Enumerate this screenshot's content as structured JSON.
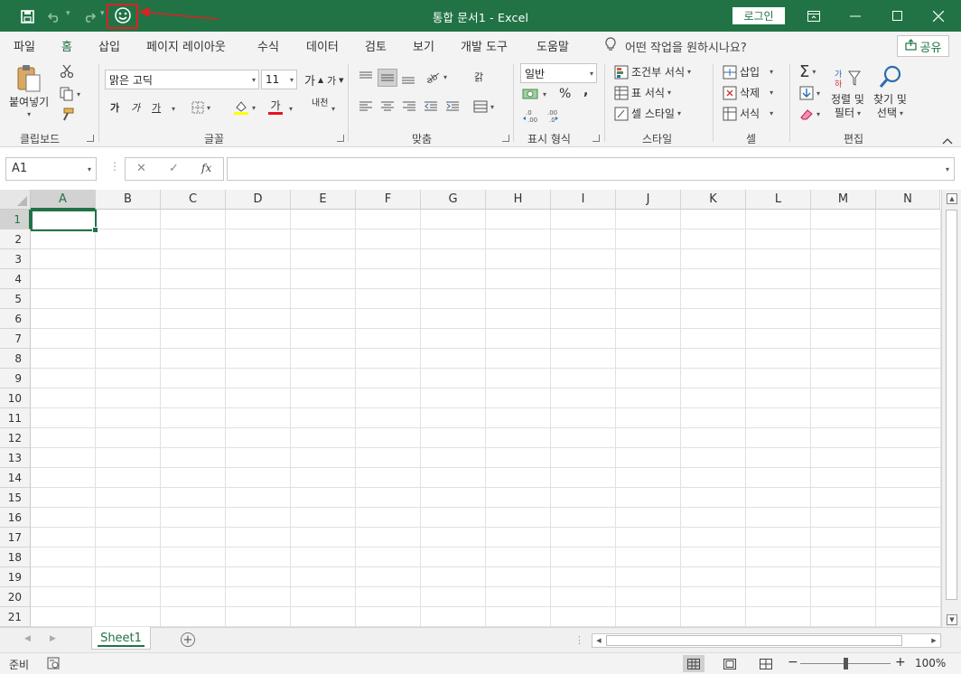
{
  "titlebar": {
    "title": "통합 문서1  -  Excel",
    "login_label": "로그인",
    "qat": {
      "save": "save-icon",
      "undo": "undo-icon",
      "redo": "redo-icon",
      "feedback": "smiley-icon"
    }
  },
  "tabs": [
    {
      "label": "파일"
    },
    {
      "label": "홈"
    },
    {
      "label": "삽입"
    },
    {
      "label": "페이지 레이아웃"
    },
    {
      "label": "수식"
    },
    {
      "label": "데이터"
    },
    {
      "label": "검토"
    },
    {
      "label": "보기"
    },
    {
      "label": "개발 도구"
    },
    {
      "label": "도움말"
    }
  ],
  "tell_me": "어떤 작업을 원하시나요?",
  "share_label": "공유",
  "ribbon": {
    "clipboard": {
      "paste_label": "붙여넣기",
      "group_label": "클립보드"
    },
    "font": {
      "font_name": "맑은 고딕",
      "font_size": "11",
      "grow": "가",
      "shrink": "가",
      "bold": "가",
      "italic": "가",
      "underline": "가",
      "font_color": "가",
      "phonetic": "내천",
      "group_label": "글꼴"
    },
    "alignment": {
      "wrap": "갉",
      "group_label": "맞춤"
    },
    "number": {
      "format": "일반",
      "percent": "%",
      "comma": ",",
      "group_label": "표시 형식"
    },
    "styles": {
      "conditional": "조건부 서식",
      "table": "표 서식",
      "cell_styles": "셀 스타일",
      "group_label": "스타일"
    },
    "cells": {
      "insert": "삽입",
      "delete": "삭제",
      "format": "서식",
      "group_label": "셀"
    },
    "editing": {
      "sort_line1": "정렬 및",
      "sort_line2": "필터",
      "find_line1": "찾기 및",
      "find_line2": "선택",
      "group_label": "편집"
    }
  },
  "formula_bar": {
    "name_box": "A1",
    "fx": "fx",
    "formula": ""
  },
  "grid": {
    "columns": [
      "A",
      "B",
      "C",
      "D",
      "E",
      "F",
      "G",
      "H",
      "I",
      "J",
      "K",
      "L",
      "M",
      "N"
    ],
    "rows": [
      "1",
      "2",
      "3",
      "4",
      "5",
      "6",
      "7",
      "8",
      "9",
      "10",
      "11",
      "12",
      "13",
      "14",
      "15",
      "16",
      "17",
      "18",
      "19",
      "20",
      "21"
    ],
    "active_cell": "A1"
  },
  "sheets": [
    {
      "label": "Sheet1"
    }
  ],
  "status": {
    "ready": "준비",
    "zoom": "100%",
    "minus": "−",
    "plus": "+"
  }
}
